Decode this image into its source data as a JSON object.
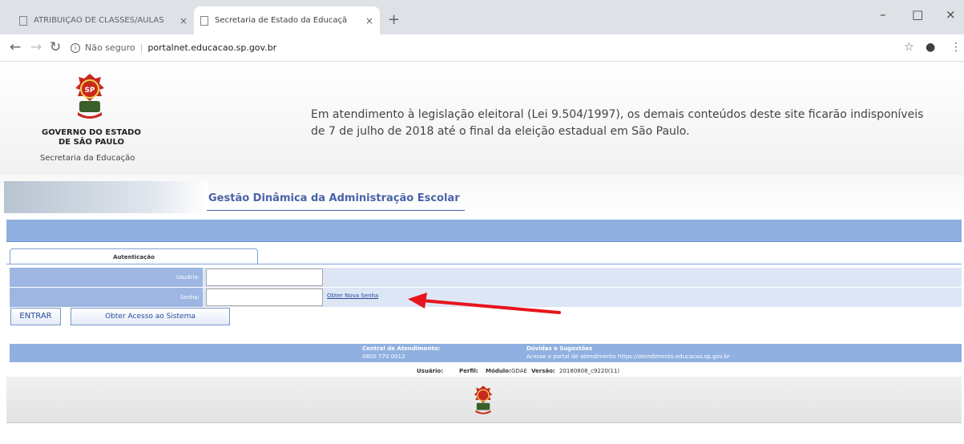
{
  "browser": {
    "tabs": [
      {
        "title": "ATRIBUIÇÃO DE CLASSES/AULAS",
        "close": "×",
        "active": false
      },
      {
        "title": "Secretaria de Estado da Educaçã",
        "close": "×",
        "active": true
      }
    ],
    "new_tab": "+",
    "window_controls": {
      "minimize": "–",
      "maximize": "□",
      "close": "×"
    },
    "nav": {
      "back": "←",
      "forward": "→",
      "reload": "↻"
    },
    "address": {
      "security": "Não seguro",
      "url": "portalnet.educacao.sp.gov.br",
      "info_glyph": "i"
    },
    "actions": {
      "star": "☆",
      "account": "●",
      "menu": "⋮"
    }
  },
  "header": {
    "org_line1": "GOVERNO DO ESTADO",
    "org_line2": "DE SÃO PAULO",
    "department": "Secretaria da Educação",
    "notice": "Em atendimento à legislação eleitoral (Lei 9.504/1997), os demais conteúdos deste site ficarão indisponíveis de 7 de julho de 2018 até o final da eleição estadual em São Paulo."
  },
  "banner": {
    "title": "Gestão Dinâmica da Administração Escolar"
  },
  "auth": {
    "tab_label": "Autenticação",
    "user_label": "Usuário:",
    "user_value": "",
    "password_label": "Senha:",
    "password_value": "",
    "new_password_link": "Obter Nova Senha",
    "enter_button": "ENTRAR",
    "access_button": "Obter Acesso ao Sistema"
  },
  "support": {
    "central_label": "Central de Atendimento:",
    "central_value": "0800 770 0012",
    "doubts_label": "Dúvidas e Sugestões",
    "doubts_value": "Acesse o portal de atendimento https://atendimento.educacao.sp.gov.br"
  },
  "status": {
    "user_label": "Usuário:",
    "profile_label": "Perfil:",
    "module_label": "Módulo:",
    "module_value": "GDAE",
    "version_label": "Versão:",
    "version_value": "20180808_c9220(11)"
  },
  "colors": {
    "accent": "#4a62a8",
    "bar": "#8fb0e0",
    "arrow": "#e8141c"
  }
}
